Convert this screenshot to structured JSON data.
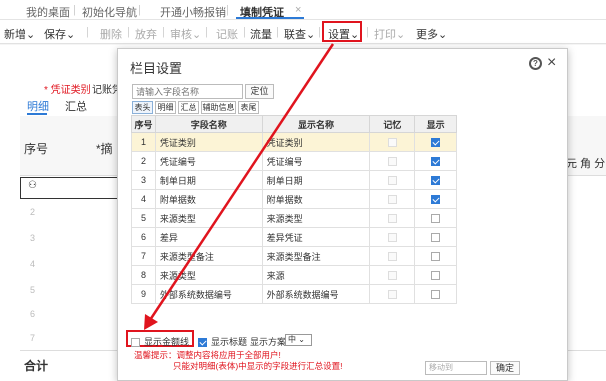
{
  "tabs": [
    {
      "label": "我的桌面"
    },
    {
      "label": "初始化导航"
    },
    {
      "label": "开通小畅报销"
    },
    {
      "label": "填制凭证"
    }
  ],
  "tab_close": "×",
  "toolbar": {
    "add": "新增⌄",
    "save": "保存⌄",
    "delete": "删除",
    "abandon": "放弃",
    "audit": "审核⌄",
    "post": "记账",
    "flow": "流量",
    "query": "联查⌄",
    "settings": "设置⌄",
    "print": "打印⌄",
    "more": "更多⌄"
  },
  "form": {
    "voucher_type_label": "* 凭证类别",
    "voucher_type_value": "记账凭",
    "subtab_detail": "明细",
    "subtab_summary": "汇总",
    "col_no": "序号",
    "col_summary": "*摘",
    "right_head": "元 角 分",
    "rows": [
      "2",
      "3",
      "4",
      "5",
      "6",
      "7"
    ],
    "total": "合计"
  },
  "dialog": {
    "title": "栏目设置",
    "help": "?",
    "close": "×",
    "search_placeholder": "请输入字段名称",
    "locate": "定位",
    "field_tabs": [
      "表头",
      "明细",
      "汇总",
      "辅助信息",
      "表尾"
    ],
    "table_headers": {
      "no": "序号",
      "field": "字段名称",
      "display": "显示名称",
      "memory": "记忆",
      "show": "显示"
    },
    "rows": [
      {
        "no": "1",
        "field": "凭证类别",
        "display": "凭证类别",
        "memory": false,
        "show": true,
        "selected": true
      },
      {
        "no": "2",
        "field": "凭证编号",
        "display": "凭证编号",
        "memory": false,
        "show": true
      },
      {
        "no": "3",
        "field": "制单日期",
        "display": "制单日期",
        "memory": false,
        "show": true
      },
      {
        "no": "4",
        "field": "附单据数",
        "display": "附单据数",
        "memory": false,
        "show": true
      },
      {
        "no": "5",
        "field": "来源类型",
        "display": "来源类型",
        "memory": false,
        "show": false
      },
      {
        "no": "6",
        "field": "差异",
        "display": "差异凭证",
        "memory": false,
        "show": false
      },
      {
        "no": "7",
        "field": "来源类型备注",
        "display": "来源类型备注",
        "memory": false,
        "show": false
      },
      {
        "no": "8",
        "field": "来源类型",
        "display": "来源",
        "memory": false,
        "show": false
      },
      {
        "no": "9",
        "field": "外部系统数据编号",
        "display": "外部系统数据编号",
        "memory": false,
        "show": false
      }
    ],
    "options": {
      "show_amount_line": "显示金额线",
      "show_title": "显示标题",
      "show_scheme": "显示方案",
      "scheme_value": "中 ⌄"
    },
    "warning_line1": "温馨提示：调整内容将应用于全部用户!",
    "warning_line2": "只能对明细(表体)中显示的字段进行汇总设置!",
    "move_to_placeholder": "移动到",
    "confirm": "确定"
  },
  "side_buttons": [
    "⤒",
    "˄",
    "˅",
    "⤓"
  ],
  "colors": {
    "accent": "#2d7ad6",
    "highlight_red": "#e0141e",
    "selected_row": "#fcf4d6"
  }
}
